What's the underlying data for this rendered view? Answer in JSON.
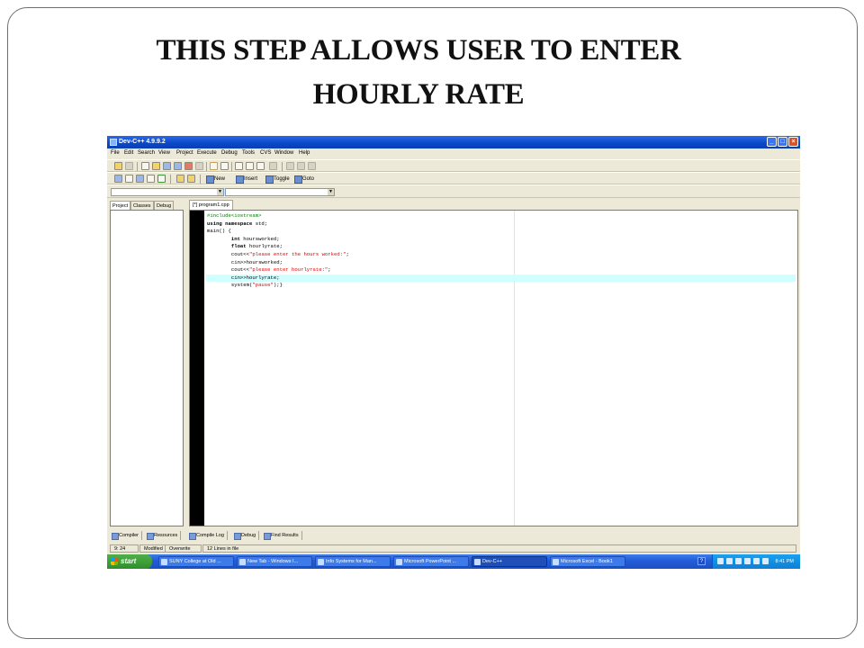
{
  "slide": {
    "title_line1": "THIS STEP ALLOWS USER TO ENTER",
    "title_line2": "HOURLY RATE"
  },
  "window": {
    "title": "Dev-C++ 4.9.9.2",
    "controls": {
      "minimize": "_",
      "maximize": "□",
      "close": "×"
    }
  },
  "menu": [
    "File",
    "Edit",
    "Search",
    "View",
    "Project",
    "Execute",
    "Debug",
    "Tools",
    "CVS",
    "Window",
    "Help"
  ],
  "toolbar": {
    "new_label": "New",
    "insert_label": "Insert",
    "toggle_label": "Toggle",
    "goto_label": "Goto"
  },
  "left_tabs": [
    "Project",
    "Classes",
    "Debug"
  ],
  "file_tab": "[*] program1.cpp",
  "code": {
    "line1": "#include<iostream>",
    "line2_kw": "using namespace",
    "line2_rest": " std;",
    "line3": "main() {",
    "line4_kw": "int",
    "line4_rest": " hoursworked;",
    "line5_kw": "float",
    "line5_rest": " hourlyrate;",
    "line6_a": "cout<<",
    "line6_str": "\"please enter the hours worked:\"",
    "line6_b": ";",
    "line7": "cin>>hoursworked;",
    "line8_a": "cout<<",
    "line8_str": "\"please enter hourlyrate:\"",
    "line8_b": ";",
    "line9": "cin>>hourlyrate;",
    "line10_a": "system(",
    "line10_str": "\"pause\"",
    "line10_b": ");}"
  },
  "bottom_tabs": [
    "Compiler",
    "Resources",
    "Compile Log",
    "Debug",
    "Find Results"
  ],
  "status": {
    "position": "9: 24",
    "modified": "Modified",
    "mode": "Overwrite",
    "lines": "12 Lines in file"
  },
  "taskbar": {
    "start_label": "start",
    "tasks": [
      "SUNY College at Old ...",
      "New Tab - Windows I...",
      "Info Systems for Man...",
      "Microsoft PowerPoint ...",
      "Dev-C++",
      "Microsoft Excel - Book1"
    ],
    "help": "?",
    "clock": "8:41 PM"
  }
}
